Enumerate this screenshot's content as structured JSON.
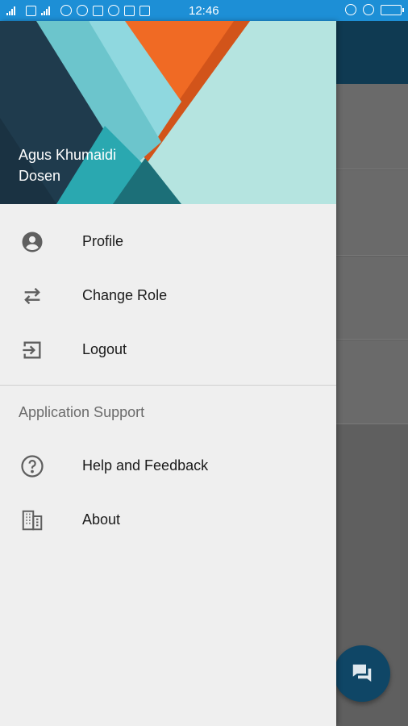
{
  "status_bar": {
    "time": "12:46",
    "color": "#1d8fd6"
  },
  "drawer": {
    "user": {
      "name": "Agus Khumaidi",
      "role": "Dosen"
    },
    "main_items": [
      {
        "label": "Profile",
        "icon": "account-circle-icon"
      },
      {
        "label": "Change Role",
        "icon": "swap-arrows-icon"
      },
      {
        "label": "Logout",
        "icon": "logout-icon"
      }
    ],
    "support_section": {
      "title": "Application Support",
      "items": [
        {
          "label": "Help and Feedback",
          "icon": "help-circle-icon"
        },
        {
          "label": "About",
          "icon": "building-icon"
        }
      ]
    }
  },
  "colors": {
    "drawer_bg": "#efefef",
    "app_bar": "#0f3a52",
    "fab": "#0f4666",
    "header_dark": "#1f3b4d",
    "header_orange": "#f06a24",
    "header_teal": "#2aa8b0",
    "header_light": "#b5e4e0"
  }
}
